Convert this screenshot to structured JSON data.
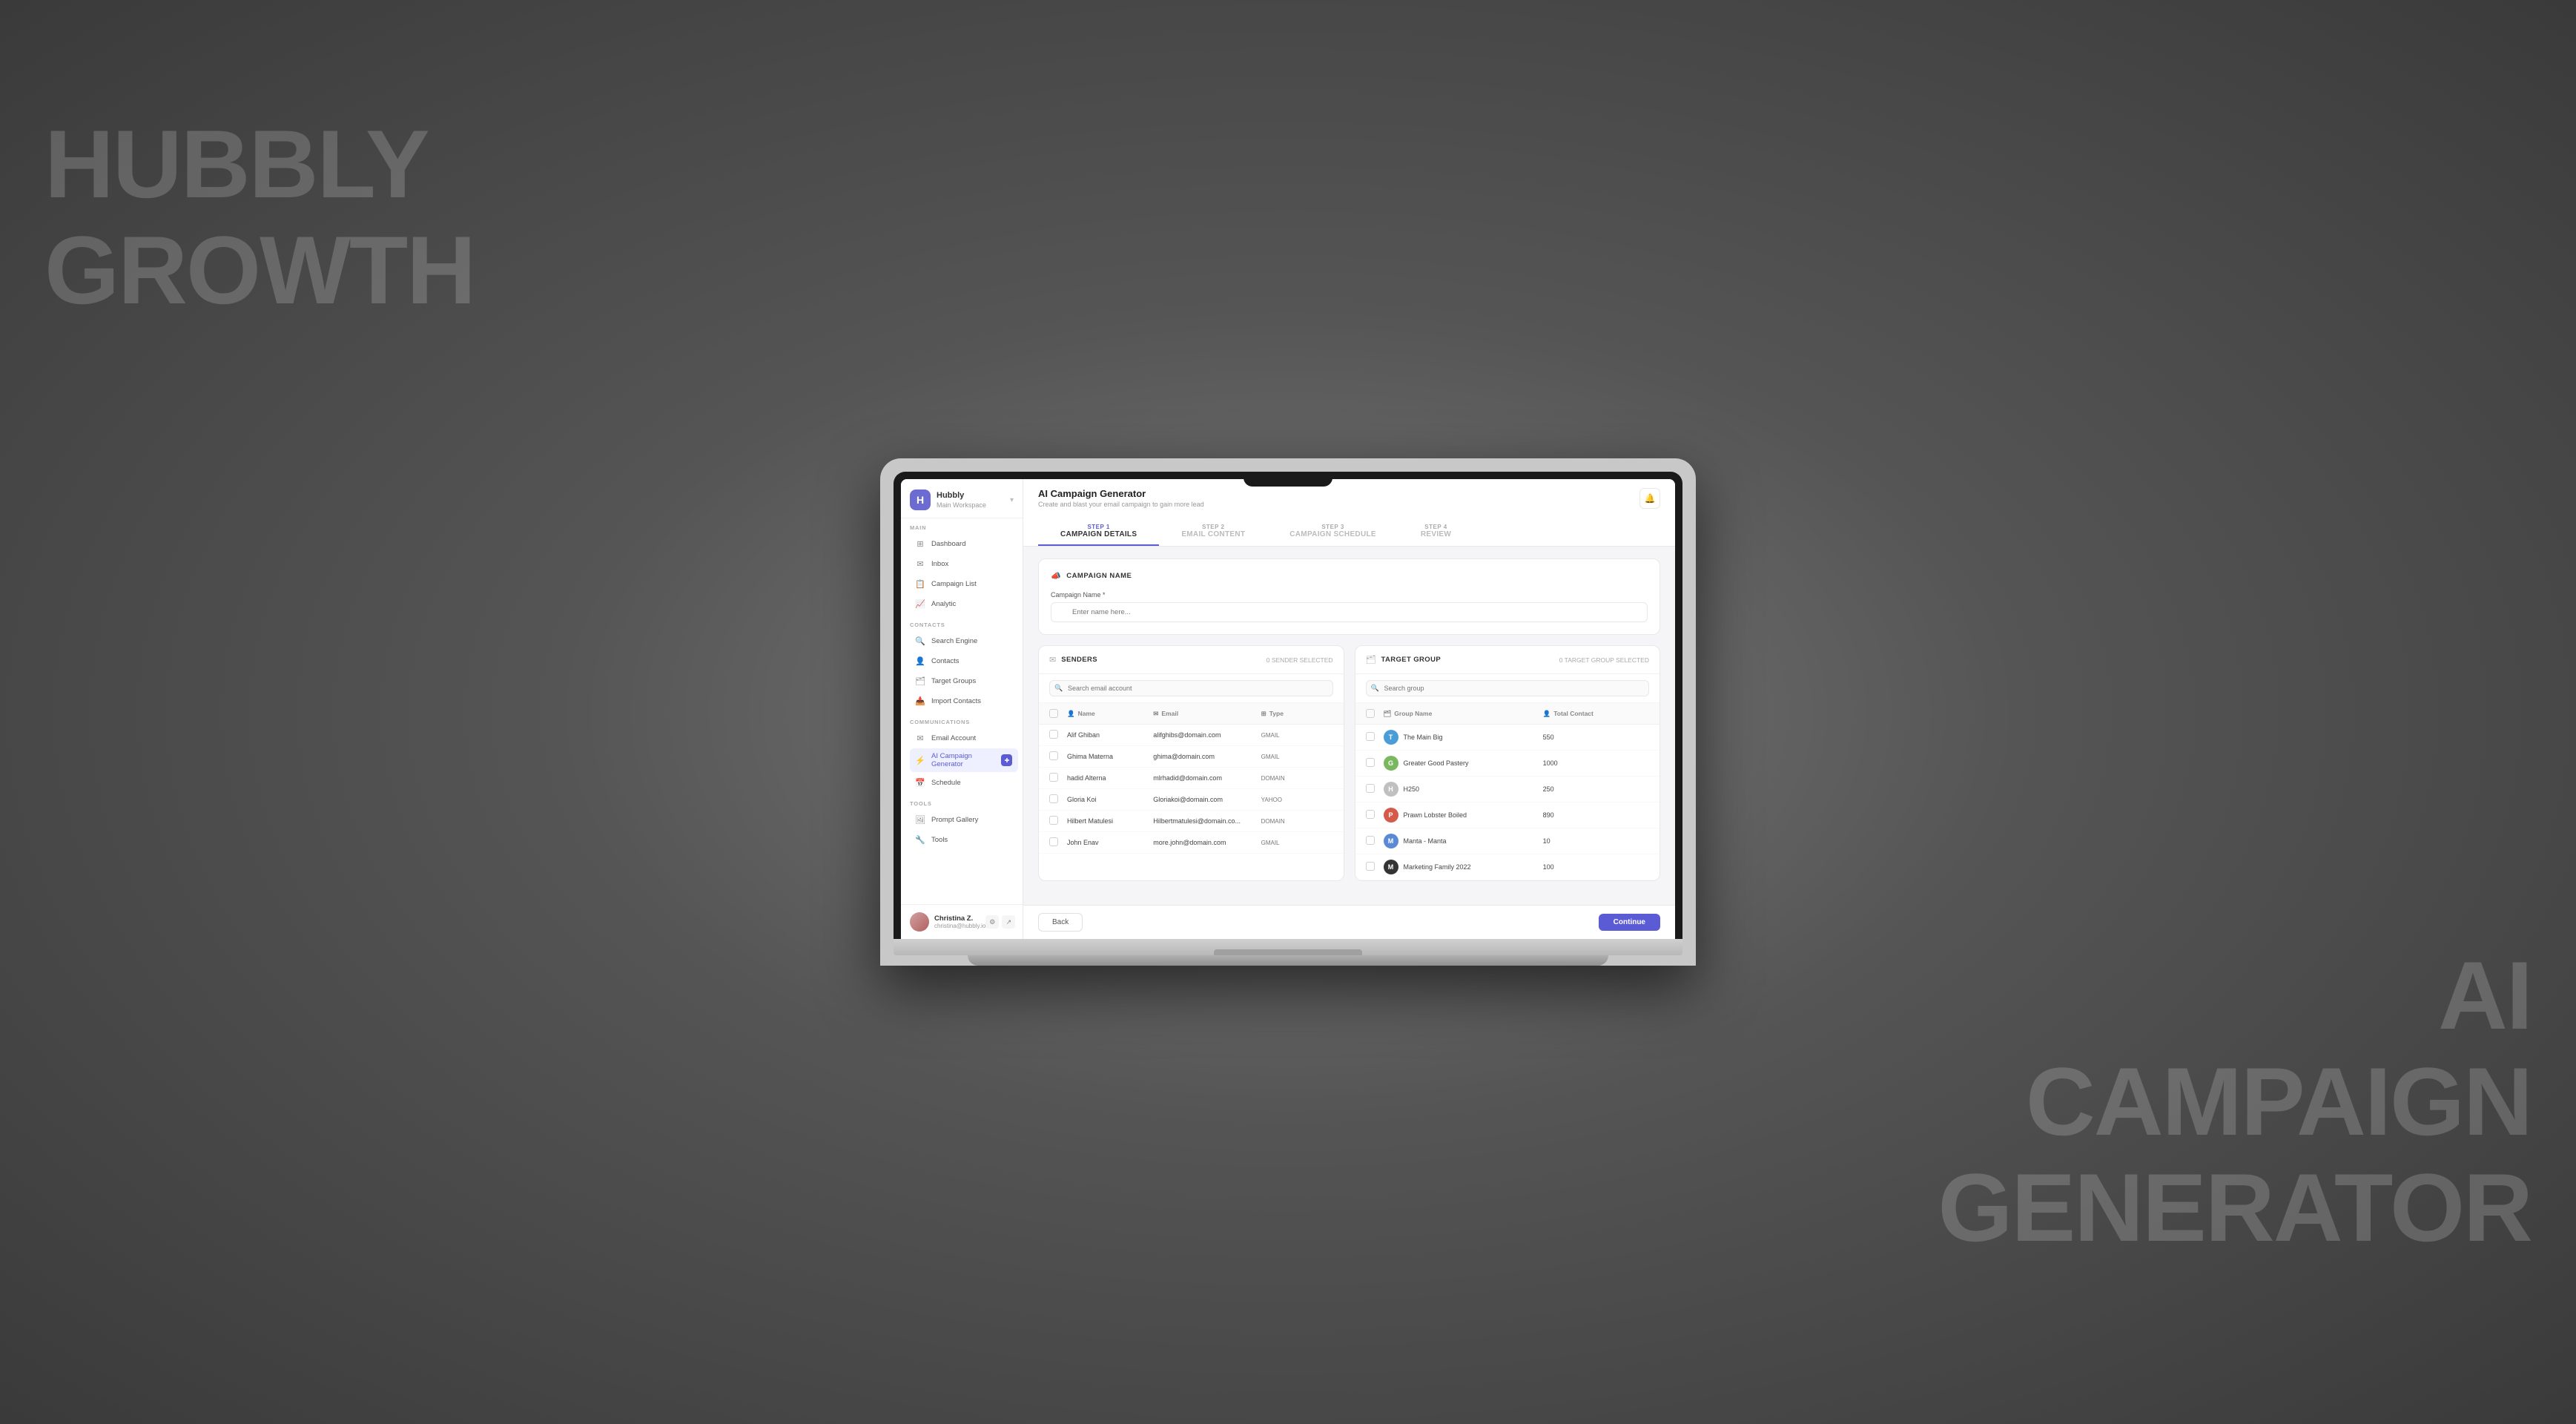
{
  "background": {
    "left_text_line1": "HUBBLY",
    "left_text_line2": "GROWTH",
    "right_text_line1": "AI",
    "right_text_line2": "CAMPAIGN",
    "right_text_line3": "GENERATOR"
  },
  "app": {
    "logo": {
      "icon": "H",
      "title": "Hubbly",
      "subtitle": "Main Workspace"
    },
    "notification_btn": "🔔"
  },
  "sidebar": {
    "sections": [
      {
        "title": "MAIN",
        "items": [
          {
            "id": "dashboard",
            "label": "Dashboard",
            "icon": "⊞",
            "active": false
          },
          {
            "id": "inbox",
            "label": "Inbox",
            "icon": "✉",
            "active": false
          },
          {
            "id": "campaign-list",
            "label": "Campaign List",
            "icon": "📋",
            "active": false
          },
          {
            "id": "analytic",
            "label": "Analytic",
            "icon": "📈",
            "active": false
          }
        ]
      },
      {
        "title": "CONTACTS",
        "items": [
          {
            "id": "search-engine",
            "label": "Search Engine",
            "icon": "🔍",
            "active": false
          },
          {
            "id": "contacts",
            "label": "Contacts",
            "icon": "👤",
            "active": false
          },
          {
            "id": "target-groups",
            "label": "Target Groups",
            "icon": "🗂",
            "active": false
          },
          {
            "id": "import-contacts",
            "label": "Import Contacts",
            "icon": "📥",
            "active": false
          }
        ]
      },
      {
        "title": "COMMUNICATIONS",
        "items": [
          {
            "id": "email-account",
            "label": "Email Account",
            "icon": "✉",
            "active": false
          },
          {
            "id": "ai-campaign",
            "label": "AI Campaign Generator",
            "icon": "⚡",
            "active": true
          },
          {
            "id": "schedule",
            "label": "Schedule",
            "icon": "📅",
            "active": false
          }
        ]
      },
      {
        "title": "TOOLS",
        "items": [
          {
            "id": "prompt-gallery",
            "label": "Prompt Gallery",
            "icon": "🖼",
            "active": false
          },
          {
            "id": "tools",
            "label": "Tools",
            "icon": "🔧",
            "active": false
          }
        ]
      }
    ],
    "user": {
      "name": "Christina Z.",
      "email": "christina@hubbly.io"
    }
  },
  "header": {
    "title": "AI Campaign Generator",
    "subtitle": "Create and blast your email campaign to gain more lead"
  },
  "steps": [
    {
      "id": "step1",
      "number": "STEP 1",
      "label": "CAMPAIGN DETAILS",
      "active": true
    },
    {
      "id": "step2",
      "number": "STEP 2",
      "label": "EMAIL CONTENT",
      "active": false
    },
    {
      "id": "step3",
      "number": "STEP 3",
      "label": "CAMPAIGN SCHEDULE",
      "active": false
    },
    {
      "id": "step4",
      "number": "STEP 4",
      "label": "REVIEW",
      "active": false
    }
  ],
  "campaign_name": {
    "section_title": "CAMPAIGN NAME",
    "field_label": "Campaign Name *",
    "field_placeholder": "Enter name here..."
  },
  "senders": {
    "title": "SENDERS",
    "badge": "0 SENDER SELECTED",
    "search_placeholder": "Search email account",
    "columns": [
      "Name",
      "Email",
      "Type"
    ],
    "rows": [
      {
        "name": "Alif Ghiban",
        "email": "alifghibs@domain.com",
        "type": "GMAIL"
      },
      {
        "name": "Ghima Materna",
        "email": "ghima@domain.com",
        "type": "GMAIL"
      },
      {
        "name": "hadid Alterna",
        "email": "mlrhadid@domain.com",
        "type": "DOMAIN"
      },
      {
        "name": "Gloria Koi",
        "email": "Gloriakoi@domain.com",
        "type": "YAHOO"
      },
      {
        "name": "Hilbert Matulesi",
        "email": "Hilbertmatulesi@domain.co...",
        "type": "DOMAIN"
      },
      {
        "name": "John Enav",
        "email": "more.john@domain.com",
        "type": "GMAIL"
      }
    ]
  },
  "target_group": {
    "title": "TARGET GROUP",
    "badge": "0 TARGET GROUP SELECTED",
    "search_placeholder": "Search group",
    "columns": [
      "Group Name",
      "Total Contact"
    ],
    "rows": [
      {
        "name": "The Main Big",
        "total": "550",
        "color": "#4a9dd6",
        "initials": "T"
      },
      {
        "name": "Greater Good Pastery",
        "total": "1000",
        "color": "#7ab860",
        "initials": "G"
      },
      {
        "name": "H250",
        "total": "250",
        "color": "#c0c0c0",
        "initials": "H"
      },
      {
        "name": "Prawn Lobster Boiled",
        "total": "890",
        "color": "#d65a4a",
        "initials": "P"
      },
      {
        "name": "Manta - Manta",
        "total": "10",
        "color": "#5a8ad6",
        "initials": "M"
      },
      {
        "name": "Marketing Family 2022",
        "total": "100",
        "color": "#333",
        "initials": "M"
      }
    ]
  },
  "footer": {
    "back_label": "Back",
    "continue_label": "Continue"
  }
}
